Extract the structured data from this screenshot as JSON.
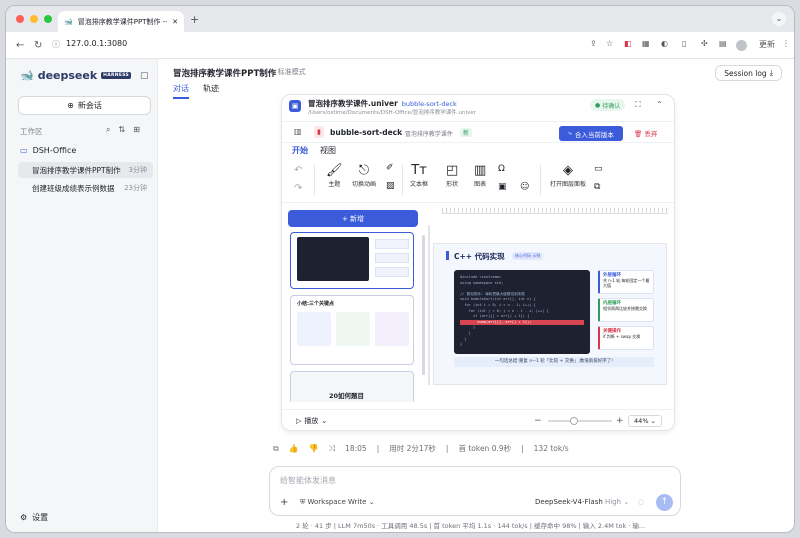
{
  "browser": {
    "tab_title": "冒泡排序教学课件PPT制作 -- Dee",
    "url": "127.0.0.1:3080",
    "profile_label": "更新"
  },
  "sidebar": {
    "brand": "deepseek",
    "brand_badge": "HARNESS",
    "new_chat": "新会话",
    "workspace_label": "工作区",
    "folder": "DSH-Office",
    "sessions": [
      {
        "name": "冒泡排序教学课件PPT制作",
        "time": "3分钟"
      },
      {
        "name": "创建班级成绩表示例数据",
        "time": "23分钟"
      }
    ],
    "settings": "设置"
  },
  "main": {
    "title": "冒泡排序教学课件PPT制作",
    "mode": "标准模式",
    "tabs": [
      "对话",
      "轨迹"
    ],
    "session_log": "Session log"
  },
  "card": {
    "file_name": "冒泡排序教学课件.univer",
    "file_badge": "bubble-sort-deck",
    "file_path": "/Users/ostime/Documents/DSH-Office/冒泡排序教学课件.univer",
    "pending": "待确认",
    "deck_name": "bubble-sort-deck",
    "deck_sub": "· 冒泡排序教学课件",
    "new_tag": "新",
    "merge_button": "合入当前版本",
    "discard_button": "丢弃",
    "menu_tabs": [
      "开始",
      "视图"
    ],
    "ribbon": {
      "theme": "主题",
      "transition": "切换动画",
      "textbox": "文本框",
      "shape": "形状",
      "chart": "图表",
      "layers": "打开图层面板"
    },
    "add_button": "+ 新增",
    "thumb2_title": "小结:三个关键点",
    "thumb3_title": "20如何题目",
    "slide_title": "C++ 代码实现",
    "slide_tag": "核心代码 示例",
    "code_lines": [
      "#include <iostream>",
      "using namespace std;",
      "",
      "// 冒泡排序: 每轮把最大值冒泡到末尾",
      "void bubbleSort(int arr[], int n) {",
      "  for (int i = 0; i < n - 1; i++) {",
      "    for (int j = 0; j < n - 1 - i; j++) {",
      "      if (arr[j] > arr[j + 1]) {",
      "        swap(arr[j], arr[j + 1]);",
      "      }",
      "    }",
      "  }",
      "}"
    ],
    "notes": [
      {
        "title": "外层循环",
        "text": "共 n-1 轮,每轮固定一个最大值"
      },
      {
        "title": "内层循环",
        "text": "相邻两两比较并按需交换"
      },
      {
        "title": "关键操作",
        "text": "if 判断 + swap 交换"
      }
    ],
    "slide_footer": "一句话总结:重复 n−1 轮「比较 + 交换」,数值就排好序了!",
    "play": "播放",
    "zoom": "44%"
  },
  "meta": {
    "time": "18:05",
    "elapsed": "用时 2分17秒",
    "first_token": "首 token 0.9秒",
    "speed": "132 tok/s"
  },
  "composer": {
    "placeholder": "给智能体发消息",
    "workspace_mode": "Workspace Write",
    "model": "DeepSeek-V4-Flash",
    "effort": "High"
  },
  "status_line": "2 轮 · 41 步  |  LLM 7m50s · 工具调用 48.5s  |  首 token 平均 1.1s · 144 tok/s  |  缓存命中 98%  |  输入 2.4M tok · 输..."
}
